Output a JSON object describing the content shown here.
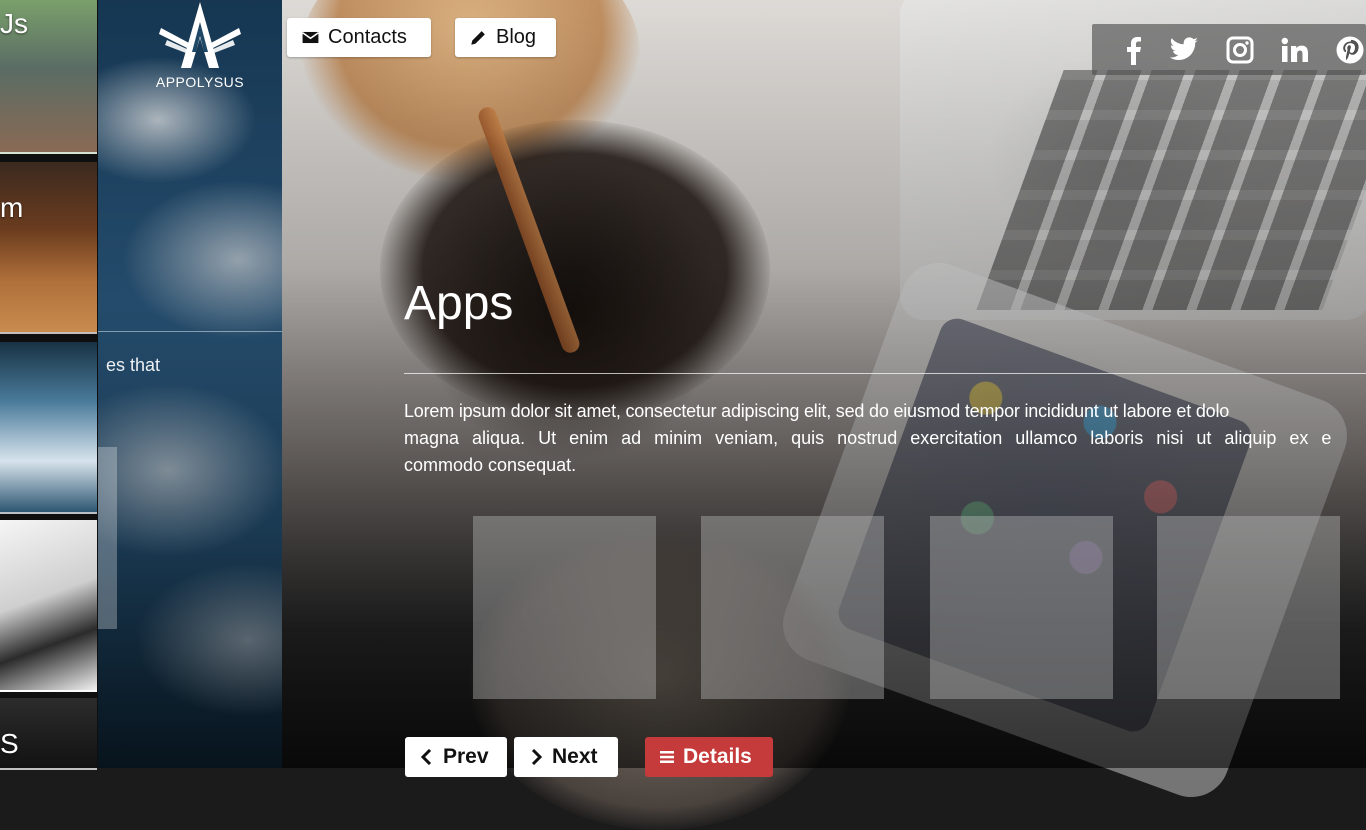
{
  "logo": {
    "text": "APPOLYSUS"
  },
  "top_nav": {
    "contacts": {
      "label": "Contacts",
      "icon": "envelope-icon"
    },
    "blog": {
      "label": "Blog",
      "icon": "pencil-icon"
    }
  },
  "social": [
    {
      "name": "facebook-icon"
    },
    {
      "name": "twitter-icon"
    },
    {
      "name": "instagram-icon"
    },
    {
      "name": "linkedin-icon"
    },
    {
      "name": "pinterest-icon"
    }
  ],
  "thumbs": [
    {
      "label": "Js"
    },
    {
      "label": "m"
    },
    {
      "label": ""
    },
    {
      "label": ""
    },
    {
      "label": "S"
    }
  ],
  "sky": {
    "text": "es that"
  },
  "section": {
    "title": "Apps",
    "description_lines": [
      "Lorem ipsum dolor sit amet, consectetur adipiscing elit, sed do eiusmod tempor incididunt ut labore et dolo",
      "magna aliqua. Ut enim ad minim veniam, quis nostrud exercitation ullamco laboris nisi ut aliquip ex e",
      "commodo consequat."
    ]
  },
  "bottom_nav": {
    "prev": {
      "label": "Prev",
      "icon": "chevron-left-icon"
    },
    "next": {
      "label": "Next",
      "icon": "chevron-right-icon"
    },
    "details": {
      "label": "Details",
      "icon": "list-icon"
    }
  },
  "colors": {
    "details": "#c53b3b",
    "accent_white": "#ffffff"
  }
}
